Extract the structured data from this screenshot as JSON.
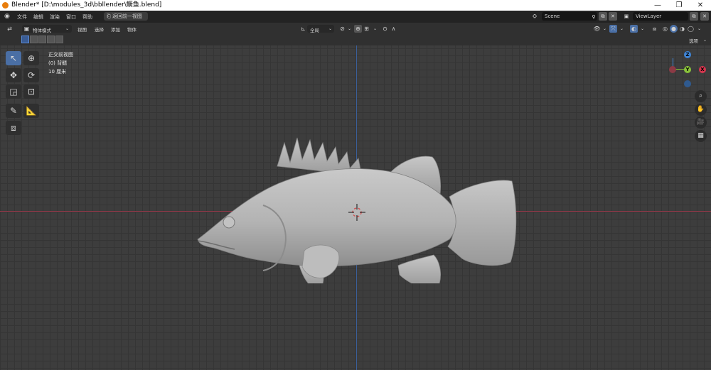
{
  "window": {
    "title": "Blender* [D:\\modules_3d\\bbllender\\鳜鱼.blend]",
    "minimize": "—",
    "maximize": "❐",
    "close": "✕"
  },
  "topbar": {
    "menu": [
      "文件",
      "编辑",
      "渲染",
      "窗口",
      "帮助"
    ],
    "back_button": "返回前一视图",
    "scene": "Scene",
    "view_layer": "ViewLayer"
  },
  "header": {
    "mode": "物体模式",
    "menus": [
      "视图",
      "选择",
      "添加",
      "物体"
    ],
    "transform_orientation": "全局",
    "options": "选项"
  },
  "viewport": {
    "info": {
      "view_name": "正交前视图",
      "collection": "(0) 背鳍",
      "scale": "10 厘米"
    },
    "gizmo": {
      "z": "Z",
      "y": "Y",
      "x": "X"
    }
  },
  "colors": {
    "accent": "#4a6fa5",
    "x_axis": "#d6364e",
    "y_axis": "#8ac23b",
    "z_axis": "#3f85d6"
  }
}
